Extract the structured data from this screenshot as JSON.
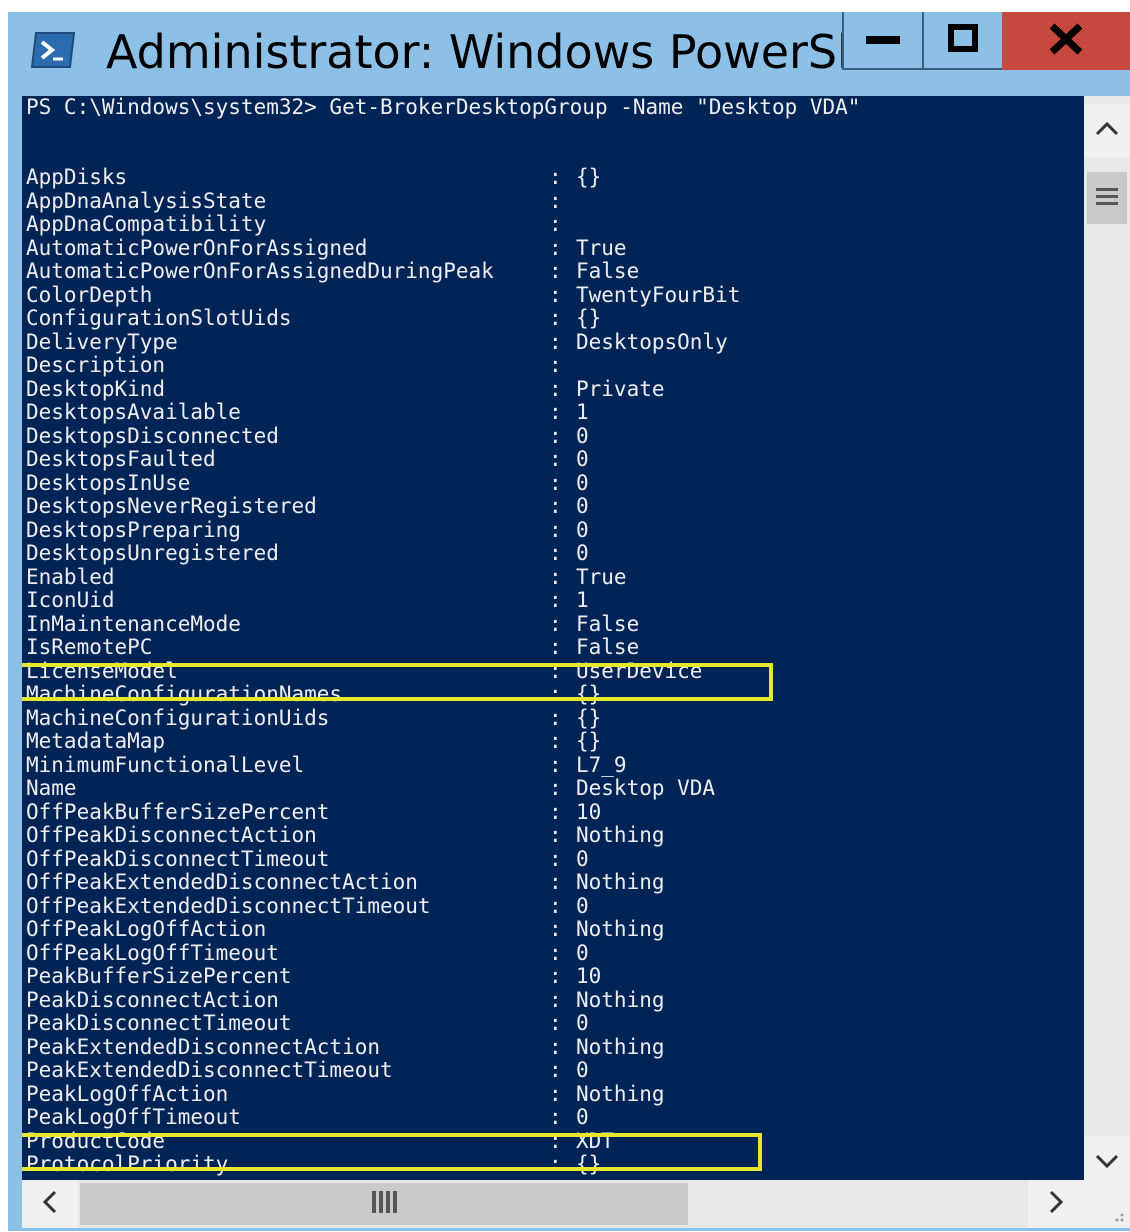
{
  "window": {
    "title": "Administrator: Windows PowerShell"
  },
  "console": {
    "command": "PS C:\\Windows\\system32> Get-BrokerDesktopGroup -Name \"Desktop VDA\"",
    "separator": ":",
    "properties": [
      {
        "name": "AppDisks",
        "value": "{}"
      },
      {
        "name": "AppDnaAnalysisState",
        "value": ""
      },
      {
        "name": "AppDnaCompatibility",
        "value": ""
      },
      {
        "name": "AutomaticPowerOnForAssigned",
        "value": "True"
      },
      {
        "name": "AutomaticPowerOnForAssignedDuringPeak",
        "value": "False"
      },
      {
        "name": "ColorDepth",
        "value": "TwentyFourBit"
      },
      {
        "name": "ConfigurationSlotUids",
        "value": "{}"
      },
      {
        "name": "DeliveryType",
        "value": "DesktopsOnly"
      },
      {
        "name": "Description",
        "value": ""
      },
      {
        "name": "DesktopKind",
        "value": "Private"
      },
      {
        "name": "DesktopsAvailable",
        "value": "1"
      },
      {
        "name": "DesktopsDisconnected",
        "value": "0"
      },
      {
        "name": "DesktopsFaulted",
        "value": "0"
      },
      {
        "name": "DesktopsInUse",
        "value": "0"
      },
      {
        "name": "DesktopsNeverRegistered",
        "value": "0"
      },
      {
        "name": "DesktopsPreparing",
        "value": "0"
      },
      {
        "name": "DesktopsUnregistered",
        "value": "0"
      },
      {
        "name": "Enabled",
        "value": "True"
      },
      {
        "name": "IconUid",
        "value": "1"
      },
      {
        "name": "InMaintenanceMode",
        "value": "False"
      },
      {
        "name": "IsRemotePC",
        "value": "False"
      },
      {
        "name": "LicenseModel",
        "value": "UserDevice"
      },
      {
        "name": "MachineConfigurationNames",
        "value": "{}"
      },
      {
        "name": "MachineConfigurationUids",
        "value": "{}"
      },
      {
        "name": "MetadataMap",
        "value": "{}"
      },
      {
        "name": "MinimumFunctionalLevel",
        "value": "L7_9"
      },
      {
        "name": "Name",
        "value": "Desktop VDA"
      },
      {
        "name": "OffPeakBufferSizePercent",
        "value": "10"
      },
      {
        "name": "OffPeakDisconnectAction",
        "value": "Nothing"
      },
      {
        "name": "OffPeakDisconnectTimeout",
        "value": "0"
      },
      {
        "name": "OffPeakExtendedDisconnectAction",
        "value": "Nothing"
      },
      {
        "name": "OffPeakExtendedDisconnectTimeout",
        "value": "0"
      },
      {
        "name": "OffPeakLogOffAction",
        "value": "Nothing"
      },
      {
        "name": "OffPeakLogOffTimeout",
        "value": "0"
      },
      {
        "name": "PeakBufferSizePercent",
        "value": "10"
      },
      {
        "name": "PeakDisconnectAction",
        "value": "Nothing"
      },
      {
        "name": "PeakDisconnectTimeout",
        "value": "0"
      },
      {
        "name": "PeakExtendedDisconnectAction",
        "value": "Nothing"
      },
      {
        "name": "PeakExtendedDisconnectTimeout",
        "value": "0"
      },
      {
        "name": "PeakLogOffAction",
        "value": "Nothing"
      },
      {
        "name": "PeakLogOffTimeout",
        "value": "0"
      },
      {
        "name": "ProductCode",
        "value": "XDT"
      },
      {
        "name": "ProtocolPriority",
        "value": "{}"
      }
    ]
  },
  "highlights": [
    "LicenseModel",
    "ProductCode"
  ],
  "colors": {
    "console_background": "#012456",
    "console_text": "#eeedf0",
    "titlebar": "#8cc0e6",
    "close_button": "#c6483e",
    "highlight_box": "#e8e82a"
  },
  "icons": {
    "app": "powershell-icon",
    "minimize": "minimize-icon",
    "maximize": "maximize-icon",
    "close": "close-icon",
    "scroll_up": "chevron-up-icon",
    "scroll_down": "chevron-down-icon",
    "scroll_left": "chevron-left-icon",
    "scroll_right": "chevron-right-icon"
  }
}
